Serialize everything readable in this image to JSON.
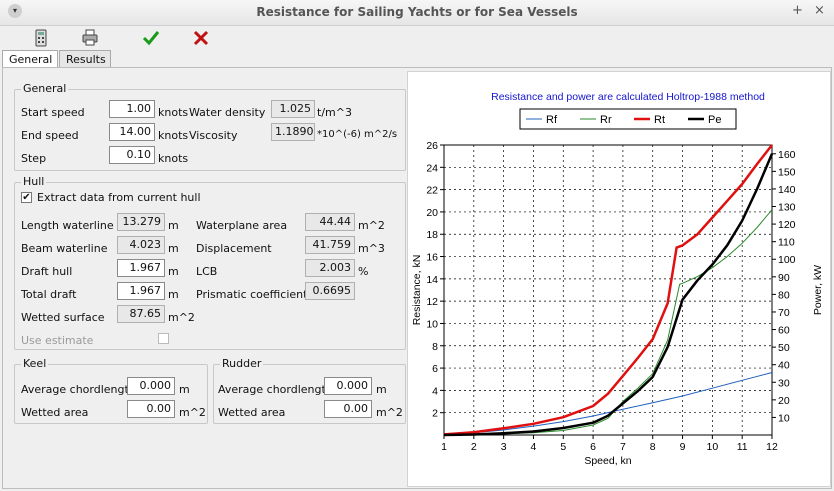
{
  "window": {
    "title": "Resistance for Sailing Yachts or for Sea Vessels",
    "min_glyph": "+",
    "close_glyph": "×",
    "menu_glyph": "▾"
  },
  "toolbar": [
    "calculator-icon",
    "printer-icon",
    "check-icon",
    "cross-icon"
  ],
  "tabs": [
    "General",
    "Results"
  ],
  "general": {
    "title": "General",
    "start_speed": {
      "label": "Start speed",
      "value": "1.00",
      "unit": "knots"
    },
    "end_speed": {
      "label": "End speed",
      "value": "14.00",
      "unit": "knots"
    },
    "step": {
      "label": "Step",
      "value": "0.10",
      "unit": "knots"
    },
    "water_density": {
      "label": "Water density",
      "value": "1.025",
      "unit": "t/m^3"
    },
    "viscosity": {
      "label": "Viscosity",
      "value": "1.1890",
      "unit": "*10^(-6) m^2/s"
    }
  },
  "hull": {
    "title": "Hull",
    "extract_label": "Extract data from current hull",
    "extract_checked": "✔",
    "length_waterline": {
      "label": "Length waterline",
      "value": "13.279",
      "unit": "m"
    },
    "beam_waterline": {
      "label": "Beam waterline",
      "value": "4.023",
      "unit": "m"
    },
    "draft_hull": {
      "label": "Draft hull",
      "value": "1.967",
      "unit": "m"
    },
    "total_draft": {
      "label": "Total draft",
      "value": "1.967",
      "unit": "m"
    },
    "wetted_surface": {
      "label": "Wetted surface",
      "value": "87.65",
      "unit": "m^2"
    },
    "use_estimate_label": "Use estimate",
    "waterplane_area": {
      "label": "Waterplane area",
      "value": "44.44",
      "unit": "m^2"
    },
    "displacement": {
      "label": "Displacement",
      "value": "41.759",
      "unit": "m^3"
    },
    "lcb": {
      "label": "LCB",
      "value": "2.003",
      "unit": "%"
    },
    "prismatic": {
      "label": "Prismatic coefficient",
      "value": "0.6695"
    }
  },
  "keel": {
    "title": "Keel",
    "chord_label": "Average chordlength",
    "chord_value": "0.000",
    "chord_unit": "m",
    "wetted_label": "Wetted area",
    "wetted_value": "0.00",
    "wetted_unit": "m^2"
  },
  "rudder": {
    "title": "Rudder",
    "chord_label": "Average chordlength",
    "chord_value": "0.000",
    "chord_unit": "m",
    "wetted_label": "Wetted area",
    "wetted_value": "0.00",
    "wetted_unit": "m^2"
  },
  "chart_data": {
    "type": "line",
    "title": "Resistance and power are calculated Holtrop-1988 method",
    "xlabel": "Speed, kn",
    "ylabel": "Resistance, kN",
    "y2label": "Power, kW",
    "xlim": [
      1,
      12
    ],
    "ylim": [
      0,
      26
    ],
    "y2lim": [
      0,
      165
    ],
    "xticks": [
      1,
      2,
      3,
      4,
      5,
      6,
      7,
      8,
      9,
      10,
      11,
      12
    ],
    "yticks": [
      2,
      4,
      6,
      8,
      10,
      12,
      14,
      16,
      18,
      20,
      22,
      24,
      26
    ],
    "y2ticks": [
      10,
      20,
      30,
      40,
      50,
      60,
      70,
      80,
      90,
      100,
      110,
      120,
      130,
      140,
      150,
      160
    ],
    "grid": true,
    "legend_position": "top",
    "series": [
      {
        "name": "Rf",
        "axis": "left",
        "color": "#2060c0",
        "width": 1,
        "x": [
          1,
          2,
          3,
          4,
          5,
          6,
          7,
          8,
          9,
          10,
          11,
          12
        ],
        "y": [
          0.05,
          0.2,
          0.45,
          0.8,
          1.2,
          1.7,
          2.3,
          2.9,
          3.5,
          4.2,
          4.9,
          5.6
        ]
      },
      {
        "name": "Rr",
        "axis": "left",
        "color": "#2a8a2a",
        "width": 1,
        "x": [
          1,
          2,
          3,
          4,
          5,
          6,
          6.5,
          7,
          7.5,
          8,
          8.5,
          8.9,
          9,
          9.5,
          10,
          10.5,
          11,
          11.5,
          12
        ],
        "y": [
          0,
          0.05,
          0.1,
          0.2,
          0.4,
          0.9,
          1.5,
          3.0,
          4.2,
          5.5,
          8.5,
          13.5,
          13.6,
          14.2,
          15.0,
          16.0,
          17.2,
          18.6,
          20.2
        ]
      },
      {
        "name": "Rt",
        "axis": "left",
        "color": "#e01010",
        "width": 2.5,
        "x": [
          1,
          2,
          3,
          4,
          5,
          6,
          6.5,
          7,
          7.5,
          8,
          8.5,
          8.8,
          9,
          9.5,
          10,
          10.5,
          11,
          11.5,
          12
        ],
        "y": [
          0.05,
          0.25,
          0.6,
          1.0,
          1.6,
          2.6,
          3.7,
          5.3,
          6.9,
          8.6,
          11.8,
          16.8,
          17.0,
          18.0,
          19.5,
          21.0,
          22.5,
          24.3,
          26.0
        ]
      },
      {
        "name": "Pe",
        "axis": "right",
        "color": "#000000",
        "width": 2.5,
        "x": [
          1,
          2,
          3,
          4,
          5,
          6,
          6.5,
          7,
          7.5,
          8,
          8.5,
          9,
          9.5,
          10,
          10.5,
          11,
          11.5,
          12
        ],
        "y": [
          0,
          0.3,
          1,
          2,
          4,
          7,
          11,
          18,
          25,
          33,
          50,
          77,
          88,
          97,
          108,
          122,
          140,
          160
        ]
      }
    ]
  }
}
